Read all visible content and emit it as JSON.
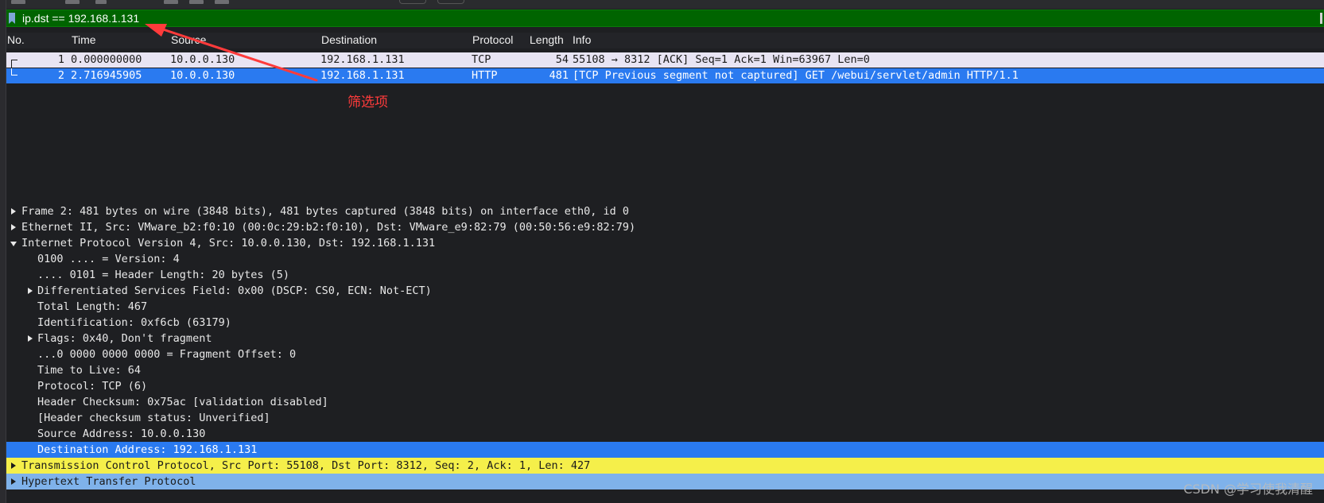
{
  "filter": {
    "value": "ip.dst == 192.168.1.131"
  },
  "columns": {
    "no": "No.",
    "time": "Time",
    "source": "Source",
    "destination": "Destination",
    "protocol": "Protocol",
    "length": "Length",
    "info": "Info"
  },
  "packets": [
    {
      "no": "1",
      "time": "0.000000000",
      "source": "10.0.0.130",
      "destination": "192.168.1.131",
      "protocol": "TCP",
      "length": "54",
      "info": "55108 → 8312 [ACK] Seq=1 Ack=1 Win=63967 Len=0",
      "bg": "#e8e4f3"
    },
    {
      "no": "2",
      "time": "2.716945905",
      "source": "10.0.0.130",
      "destination": "192.168.1.131",
      "protocol": "HTTP",
      "length": "481",
      "info": "[TCP Previous segment not captured] GET /webui/servlet/admin HTTP/1.1",
      "bg": "#2a7af0",
      "selected": true
    }
  ],
  "details": [
    "Frame 2: 481 bytes on wire (3848 bits), 481 bytes captured (3848 bits) on interface eth0, id 0",
    "Ethernet II, Src: VMware_b2:f0:10 (00:0c:29:b2:f0:10), Dst: VMware_e9:82:79 (00:50:56:e9:82:79)",
    "Internet Protocol Version 4, Src: 10.0.0.130, Dst: 192.168.1.131",
    "0100 .... = Version: 4",
    ".... 0101 = Header Length: 20 bytes (5)",
    "Differentiated Services Field: 0x00 (DSCP: CS0, ECN: Not-ECT)",
    "Total Length: 467",
    "Identification: 0xf6cb (63179)",
    "Flags: 0x40, Don't fragment",
    "...0 0000 0000 0000 = Fragment Offset: 0",
    "Time to Live: 64",
    "Protocol: TCP (6)",
    "Header Checksum: 0x75ac [validation disabled]",
    "[Header checksum status: Unverified]",
    "Source Address: 10.0.0.130",
    "Destination Address: 192.168.1.131",
    "Transmission Control Protocol, Src Port: 55108, Dst Port: 8312, Seq: 2, Ack: 1, Len: 427",
    "Hypertext Transfer Protocol"
  ],
  "annotation": {
    "label": "筛选项",
    "color": "#ff3b3b"
  },
  "watermark": "CSDN @学习使我清醒",
  "colors": {
    "filter_bg": "#006400",
    "selected_bg": "#2a7af0",
    "tcp_bg": "#f5ef4a",
    "http_bg": "#7fb2ea"
  }
}
